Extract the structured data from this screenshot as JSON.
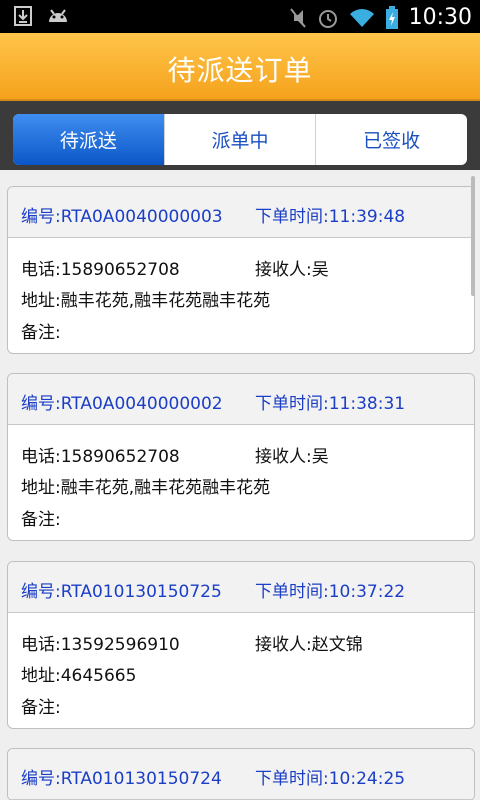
{
  "status_bar": {
    "time": "10:30",
    "left_icons": [
      "download-icon",
      "android-icon"
    ],
    "right_icons": [
      "mute-icon",
      "alarm-icon",
      "wifi-icon",
      "battery-charging-icon"
    ]
  },
  "header": {
    "title": "待派送订单"
  },
  "tabs": [
    {
      "label": "待派送",
      "active": true
    },
    {
      "label": "派单中",
      "active": false
    },
    {
      "label": "已签收",
      "active": false
    }
  ],
  "colors": {
    "header_orange": "#f5a21c",
    "tab_active_blue": "#0b56c8",
    "link_blue": "#1b3ec6"
  },
  "orders": [
    {
      "id": "编号:RTA0A0040000003",
      "time": "下单时间:11:39:48",
      "phone": "电话:15890652708",
      "receiver": "接收人:吴",
      "address": "地址:融丰花苑,融丰花苑融丰花苑",
      "note": "备注:"
    },
    {
      "id": "编号:RTA0A0040000002",
      "time": "下单时间:11:38:31",
      "phone": "电话:15890652708",
      "receiver": "接收人:吴",
      "address": "地址:融丰花苑,融丰花苑融丰花苑",
      "note": "备注:"
    },
    {
      "id": "编号:RTA010130150725",
      "time": "下单时间:10:37:22",
      "phone": "电话:13592596910",
      "receiver": "接收人:赵文锦",
      "address": "地址:4645665",
      "note": "备注:"
    },
    {
      "id": "编号:RTA010130150724",
      "time": "下单时间:10:24:25"
    }
  ]
}
